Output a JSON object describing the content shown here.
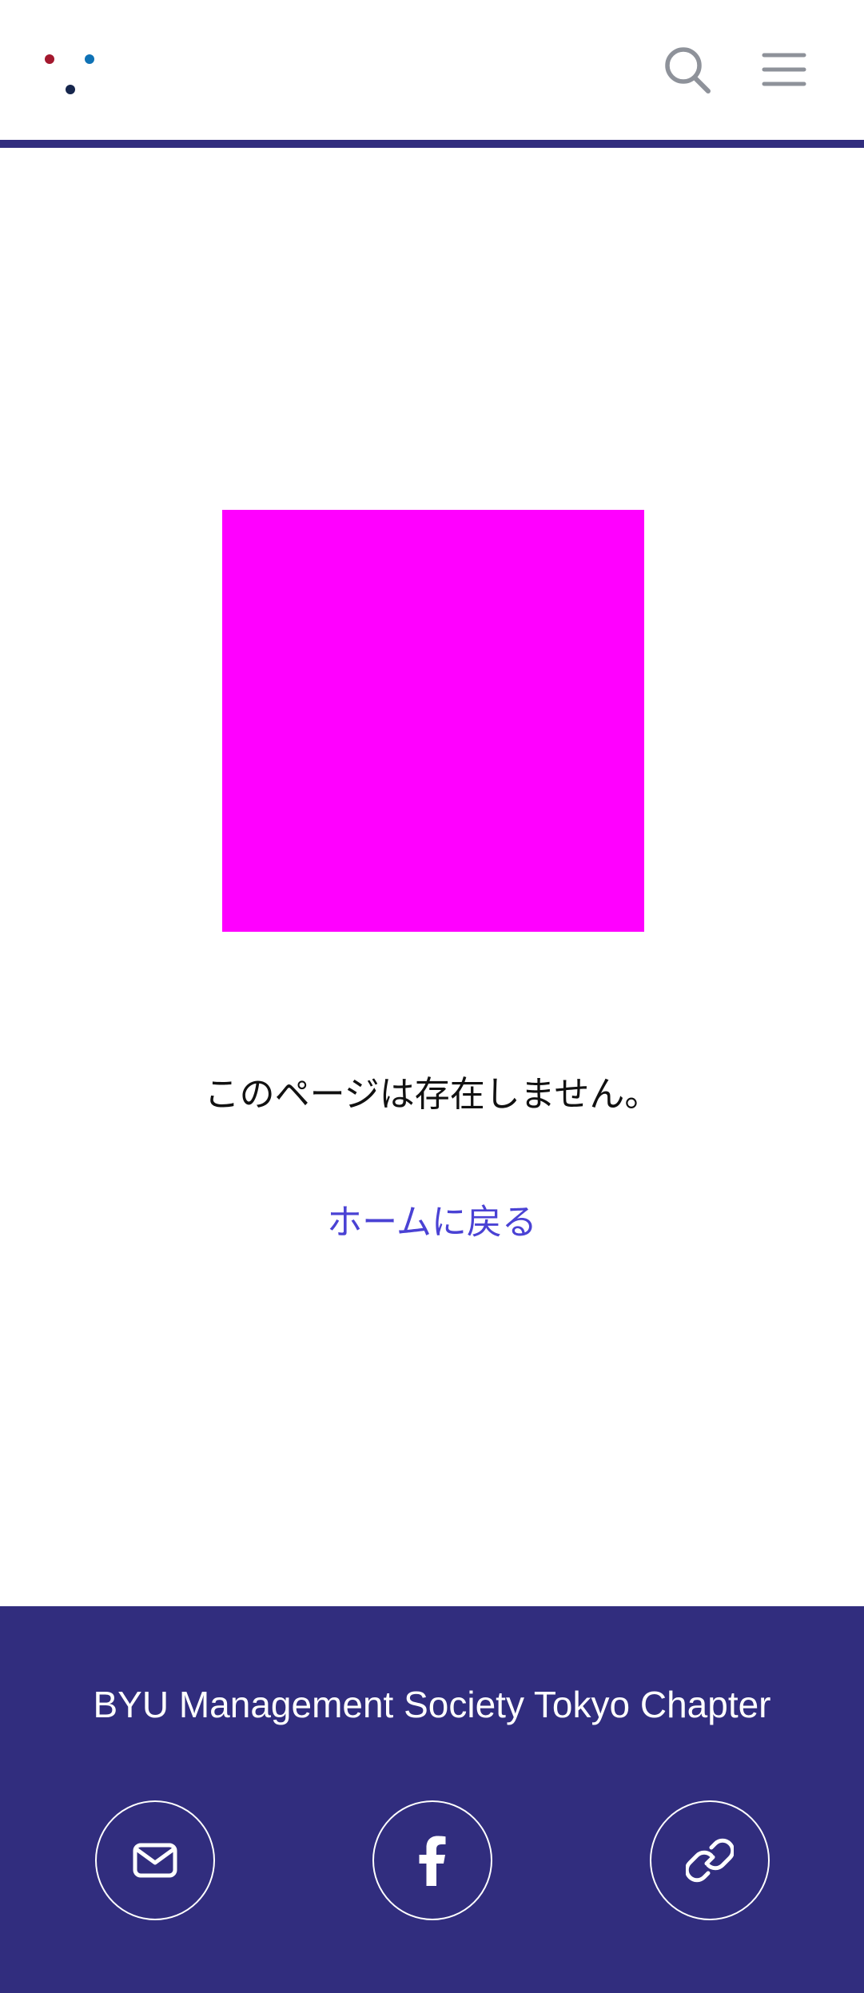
{
  "colors": {
    "brand_navy": "#312d7e",
    "link": "#4a42d4",
    "placeholder": "#ff00ff",
    "icon_gray": "#8e929a",
    "logo_red": "#a3182e",
    "logo_blue": "#0f72b5",
    "logo_navy": "#16264d"
  },
  "header": {
    "logo_icon": "three-dot-logo",
    "search_icon": "search-icon",
    "menu_icon": "hamburger-menu-icon"
  },
  "main": {
    "message": "このページは存在しません。",
    "home_link": "ホームに戻る"
  },
  "footer": {
    "title": "BYU Management Society Tokyo Chapter",
    "social": [
      {
        "icon": "mail-icon"
      },
      {
        "icon": "facebook-icon"
      },
      {
        "icon": "link-icon"
      }
    ]
  }
}
